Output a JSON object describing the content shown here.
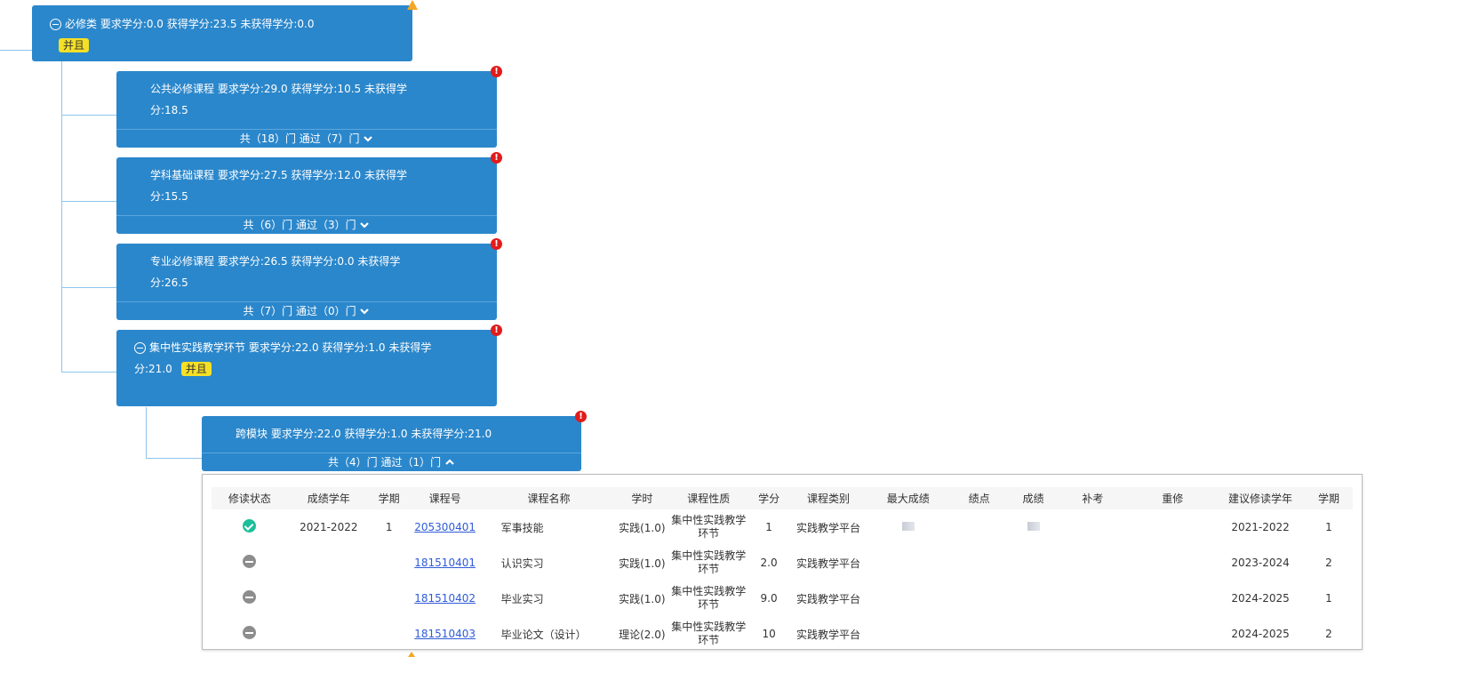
{
  "nodes": {
    "root": {
      "text": "必修类 要求学分:0.0 获得学分:23.5 未获得学分:0.0",
      "badge": "并且"
    },
    "gongong": {
      "line1": "公共必修课程 要求学分:29.0 获得学分:10.5 未获得学",
      "line2": "分:18.5",
      "summary": "共（18）门 通过（7）门"
    },
    "xueke": {
      "line1": "学科基础课程 要求学分:27.5 获得学分:12.0 未获得学",
      "line2": "分:15.5",
      "summary": "共（6）门 通过（3）门"
    },
    "zhuanye": {
      "line1": "专业必修课程 要求学分:26.5 获得学分:0.0 未获得学",
      "line2": "分:26.5",
      "summary": "共（7）门 通过（0）门"
    },
    "jizhong": {
      "line1": "集中性实践教学环节 要求学分:22.0 获得学分:1.0 未获得学",
      "line2": "分:21.0",
      "badge": "并且"
    },
    "kuamokuai": {
      "line1": "跨模块 要求学分:22.0 获得学分:1.0 未获得学分:21.0",
      "summary": "共（4）门 通过（1）门"
    }
  },
  "table": {
    "headers": [
      "修读状态",
      "成绩学年",
      "学期",
      "课程号",
      "课程名称",
      "学时",
      "课程性质",
      "学分",
      "课程类别",
      "最大成绩",
      "绩点",
      "成绩",
      "补考",
      "重修",
      "建议修读学年",
      "学期"
    ],
    "rows": [
      {
        "status": "passed",
        "year": "2021-2022",
        "term": "1",
        "code": "205300401",
        "name": "军事技能",
        "hours": "实践(1.0)",
        "nature": "集中性实践教学环节",
        "credit": "1",
        "category": "实践教学平台",
        "suggest_year": "2021-2022",
        "suggest_term": "1",
        "has_scores": true
      },
      {
        "status": "none",
        "year": "",
        "term": "",
        "code": "181510401",
        "name": "认识实习",
        "hours": "实践(1.0)",
        "nature": "集中性实践教学环节",
        "credit": "2.0",
        "category": "实践教学平台",
        "suggest_year": "2023-2024",
        "suggest_term": "2",
        "has_scores": false
      },
      {
        "status": "none",
        "year": "",
        "term": "",
        "code": "181510402",
        "name": "毕业实习",
        "hours": "实践(1.0)",
        "nature": "集中性实践教学环节",
        "credit": "9.0",
        "category": "实践教学平台",
        "suggest_year": "2024-2025",
        "suggest_term": "1",
        "has_scores": false
      },
      {
        "status": "none",
        "year": "",
        "term": "",
        "code": "181510403",
        "name": "毕业论文（设计）",
        "hours": "理论(2.0)",
        "nature": "集中性实践教学环节",
        "credit": "10",
        "category": "实践教学平台",
        "suggest_year": "2024-2025",
        "suggest_term": "2",
        "has_scores": false
      }
    ]
  },
  "colors": {
    "node_bg": "#2b87cb",
    "badge_bg": "#f5e025",
    "error_mark": "#e21b1b",
    "warn_mark": "#f5a623",
    "passed": "#1bbf9a",
    "not_taken": "#8d8d8d",
    "link": "#2f5bd8"
  },
  "icons": {
    "collapse": "minus-circle-icon",
    "expand": "chevron-down-icon",
    "collapse_list": "chevron-up-icon",
    "error": "exclamation-icon",
    "warning": "warning-triangle-icon"
  }
}
